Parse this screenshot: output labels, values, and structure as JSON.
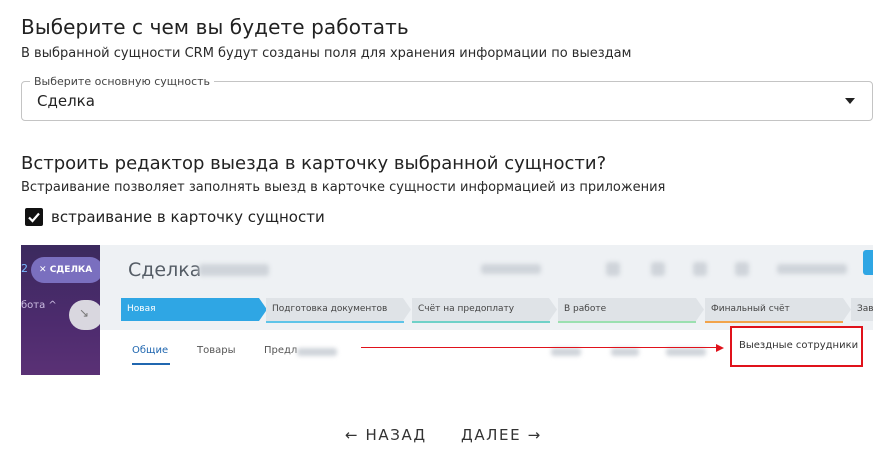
{
  "section1": {
    "title": "Выберите с чем вы будете работать",
    "subtitle": "В выбранной сущности CRM будут созданы поля для хранения информации по выездам"
  },
  "entity_select": {
    "label": "Выберите основную сущность",
    "value": "Сделка",
    "arrow_icon": "triangle-down-icon"
  },
  "section2": {
    "title": "Встроить редактор выезда в карточку выбранной сущности?",
    "subtitle": "Встраивание позволяет заполнять выезд в карточке сущности информацией из приложения",
    "checkbox_label": "встраивание в карточку сущности",
    "checkbox_checked": true
  },
  "preview": {
    "sidebar_pill": "СДЕЛКА",
    "sidebar_num": "2",
    "sidebar_text": "бота ^",
    "deal_title": "Сделка",
    "stages": [
      "Новая",
      "Подготовка документов",
      "Счёт на предоплату",
      "В работе",
      "Финальный счёт",
      "Зав"
    ],
    "tabs": [
      "Общие",
      "Товары",
      "Предл"
    ],
    "highlight_tab": "Выездные сотрудники",
    "colors": {
      "active_stage": "#2fa6e4",
      "highlight": "#e0121b",
      "sidebar": "#4d2b6e"
    }
  },
  "navigation": {
    "back_label": "← НАЗАД",
    "next_label": "ДАЛЕЕ →"
  }
}
